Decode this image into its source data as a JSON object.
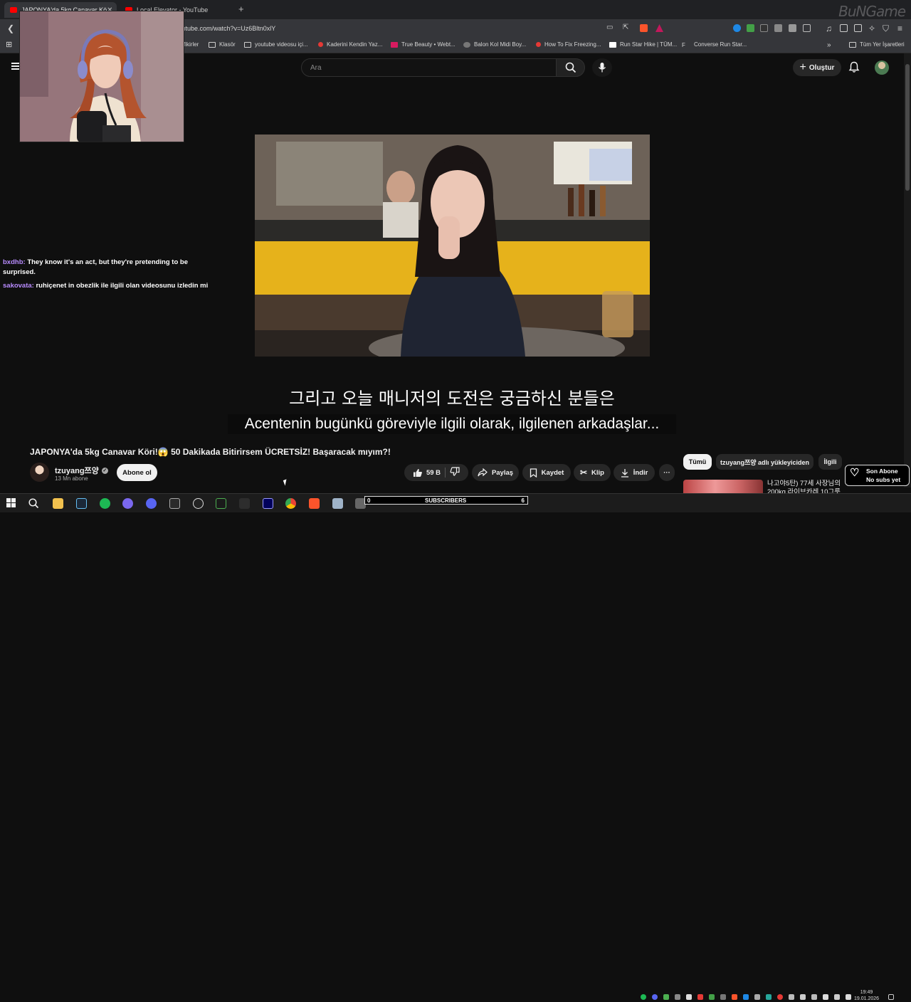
{
  "browser": {
    "tabs": [
      {
        "title": "JAPONYA'da 5kg Canavar Kö",
        "active": true
      },
      {
        "title": "Local Elevator - YouTube",
        "active": false
      }
    ],
    "url": "ıtube.com/watch?v=Uz6Bltn0xlY",
    "watermark": "BuNGame",
    "bookmarks": [
      "fikirler",
      "Klasör",
      "youtube videosu içi...",
      "Kaderini Kendin Yaz...",
      "True Beauty • Webt...",
      "Balon Kol Midi Boy...",
      "How To Fix Freezing...",
      "Run Star Hike | TÜM...",
      "Converse Run Star...",
      "Tüm Yer İşaretleri"
    ],
    "more_bookmarks": "»"
  },
  "youtube": {
    "search_placeholder": "Ara",
    "create_label": "Oluştur"
  },
  "chat": [
    {
      "user": "bxdhb:",
      "message": "They know it's an act, but they're pretending to be surprised."
    },
    {
      "user": "sakovata:",
      "message": "ruhiçenet in obezlik ile ilgili olan videosunu izledin mi"
    }
  ],
  "video": {
    "subtitle_korean": "그리고 오늘 매니저의 도전은 궁금하신 분들은",
    "subtitle_turkish": "Acentenin bugünkü göreviyle ilgili olarak, ilgilenen arkadaşlar...",
    "title": "JAPONYA'da 5kg Canavar Köri!😱 50 Dakikada Bitirirsem ÜCRETSİZ! Başaracak mıyım?!",
    "channel_name": "tzuyang쯔양",
    "channel_subs": "13 Mn abone",
    "subscribe_label": "Abone ol",
    "like_count": "59 B",
    "share_label": "Paylaş",
    "save_label": "Kaydet",
    "clip_label": "Klip",
    "download_label": "İndir",
    "more_label": "···"
  },
  "sidebar_chips": [
    "Tümü",
    "tzuyang쯔양 adlı yükleyiciden",
    "İlgili"
  ],
  "recommendation": {
    "title": "나고야5탄) 77세 사장님의 200kg 라이브카레 10그릇 먹어"
  },
  "overlay": {
    "sonabone_title": "Son Abone",
    "sonabone_value": "No subs yet",
    "subscribers_left": "0",
    "subscribers_label": "SUBSCRIBERS",
    "subscribers_right": "6"
  },
  "taskbar": {
    "time": "19:49",
    "date": "19.01.2026"
  }
}
